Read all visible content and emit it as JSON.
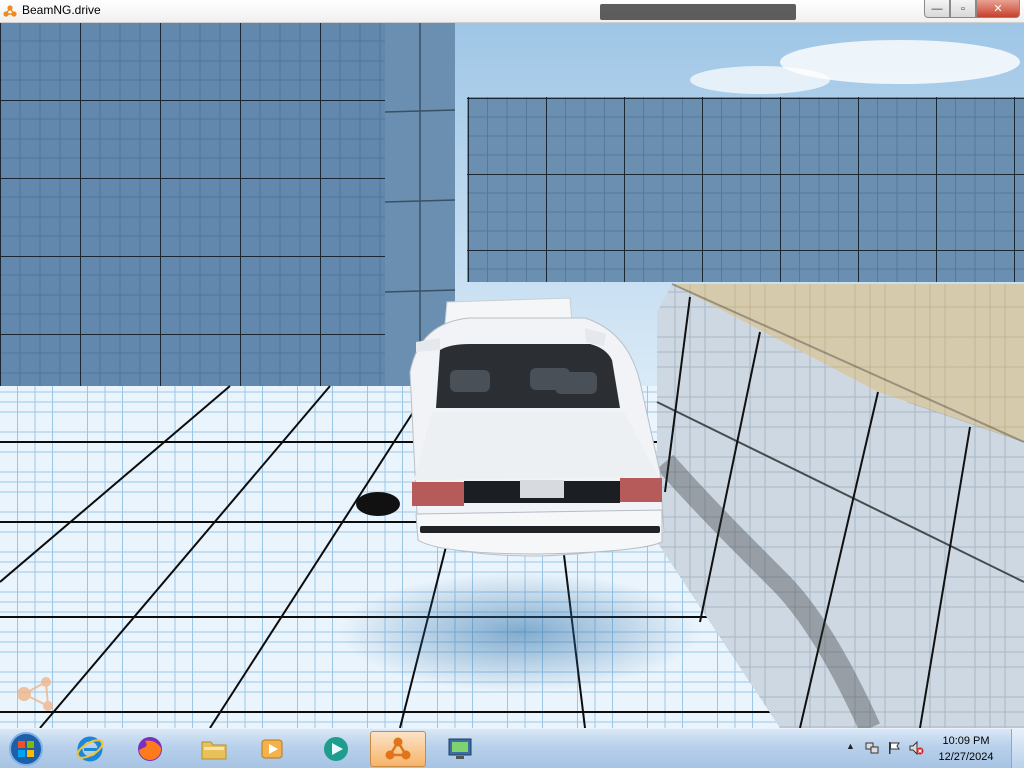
{
  "window": {
    "title": "BeamNG.drive",
    "minimize_glyph": "—",
    "maximize_glyph": "▫",
    "close_glyph": "✕"
  },
  "scene": {
    "description_icon": "car-rear-view",
    "colors": {
      "sky": "#bcd8ee",
      "wall_blue": "#5f86aa",
      "floor": "#e9f3fb",
      "gridline": "#101010",
      "block_top": "#d8ccae",
      "car_body": "#f4f6f8"
    }
  },
  "taskbar": {
    "items": [
      {
        "name": "internet-explorer",
        "icon": "ie-icon"
      },
      {
        "name": "firefox",
        "icon": "firefox-icon"
      },
      {
        "name": "file-explorer",
        "icon": "folder-icon"
      },
      {
        "name": "media-player",
        "icon": "media-icon"
      },
      {
        "name": "app-teal",
        "icon": "teal-app-icon"
      },
      {
        "name": "beamng",
        "icon": "beamng-icon",
        "active": true
      },
      {
        "name": "remote-desktop",
        "icon": "monitor-icon"
      }
    ],
    "tray": {
      "chevron": "▲",
      "time": "10:09 PM",
      "date": "12/27/2024"
    }
  }
}
